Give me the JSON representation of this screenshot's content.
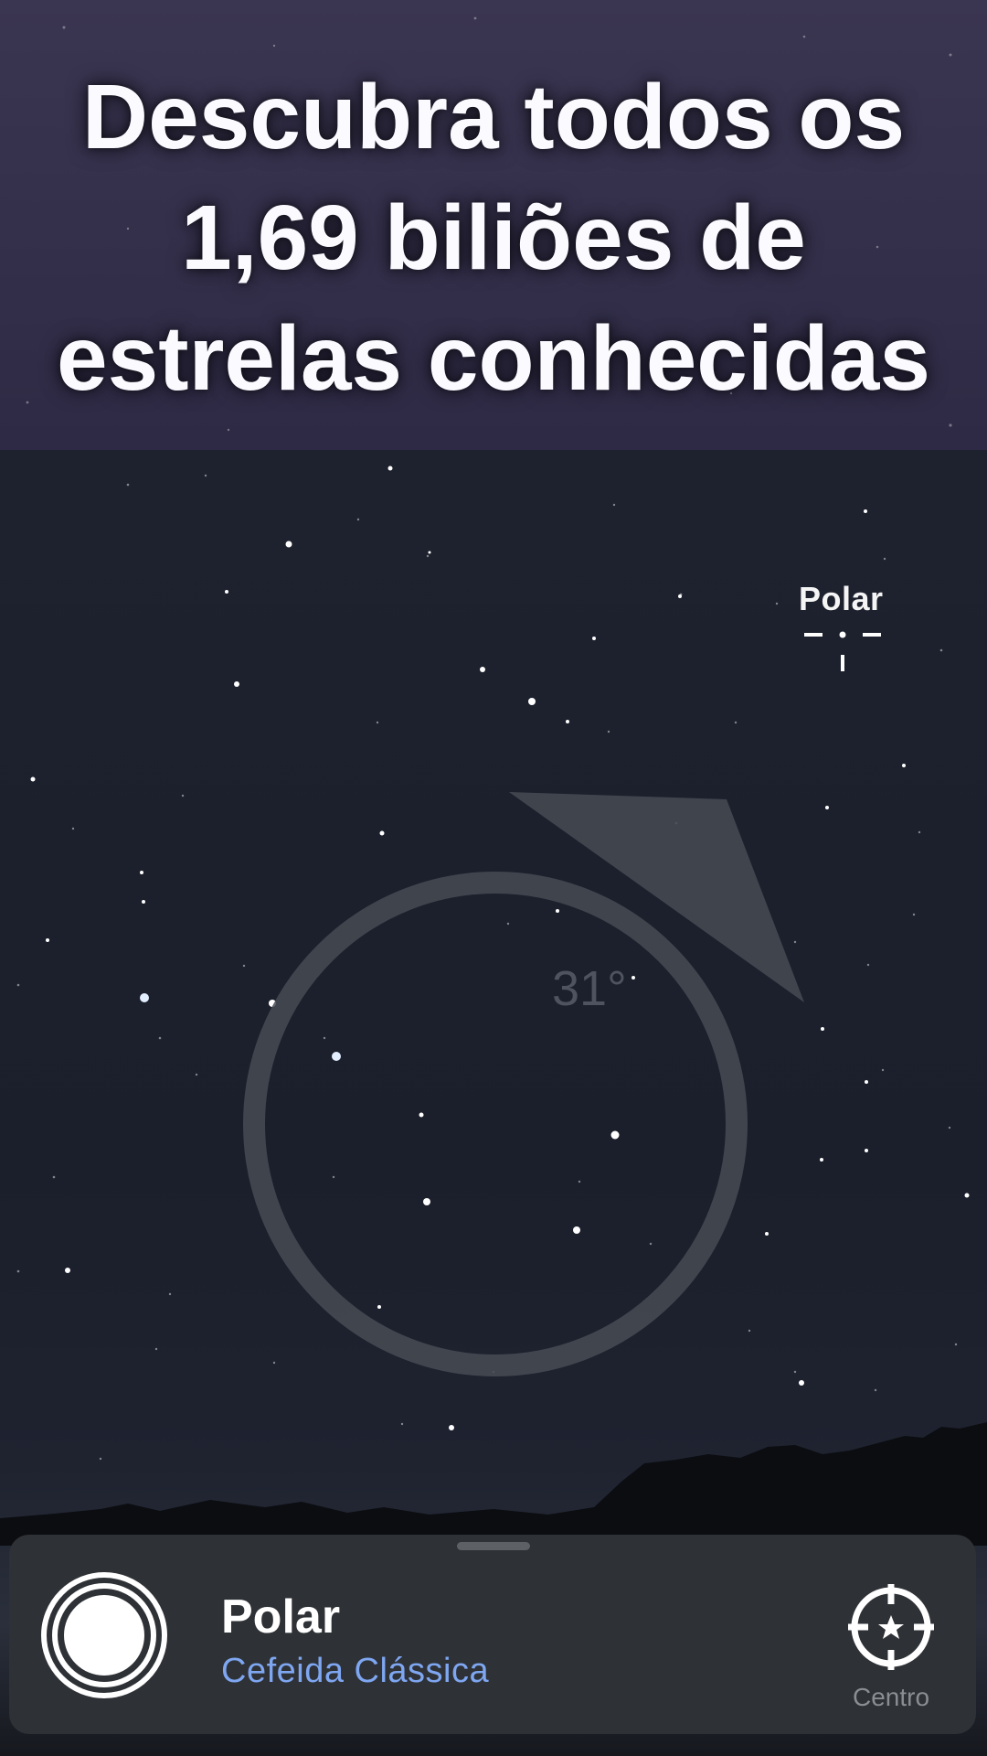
{
  "banner": {
    "title": "Descubra todos os\n1,69 biliões de\nestrelas conhecidas"
  },
  "sky": {
    "selected_star_label": "Polar",
    "angle_readout": "31°",
    "compass_icon": "direction-arrow-icon",
    "reticle_icon": "target-reticle-icon"
  },
  "info_sheet": {
    "object_name": "Polar",
    "object_type": "Cefeida Clássica",
    "object_icon": "star-rings-icon",
    "center_label": "Centro",
    "center_icon": "crosshair-star-icon"
  },
  "colors": {
    "banner_bg": "#3a3551",
    "sky_bg": "#1e222e",
    "sheet_bg": "#2e3135",
    "accent": "#7ea6f1",
    "overlay_gray": "#474b53"
  }
}
